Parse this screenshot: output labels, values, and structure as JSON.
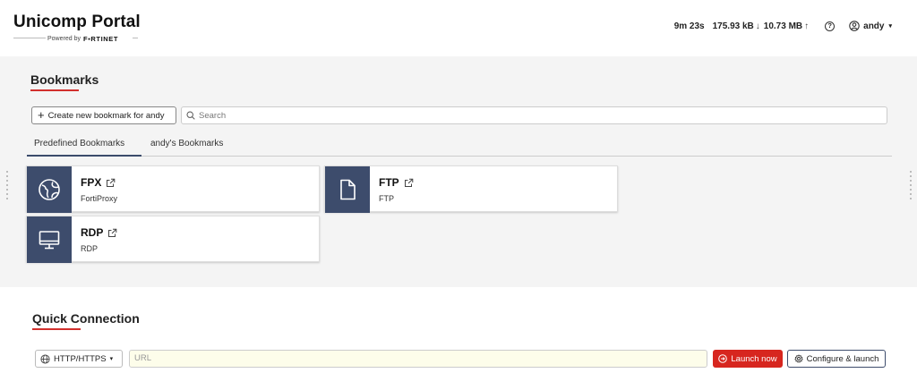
{
  "header": {
    "title": "Unicomp Portal",
    "powered_by": "Powered by",
    "fortinet": "F▪RTINET",
    "session_time": "9m 23s",
    "received": "175.93 kB",
    "received_arrow": "↓",
    "sent": "10.73 MB",
    "sent_arrow": "↑",
    "help_glyph": "?",
    "user": "andy",
    "user_caret": "▾"
  },
  "bookmarks": {
    "title": "Bookmarks",
    "create_button": "Create new bookmark for andy",
    "create_plus": "+",
    "search_placeholder": "Search",
    "tabs": [
      "Predefined Bookmarks",
      "andy's Bookmarks"
    ],
    "active_tab": 0,
    "items": [
      {
        "name": "FPX",
        "sub": "FortiProxy",
        "icon": "globe-icon"
      },
      {
        "name": "FTP",
        "sub": "FTP",
        "icon": "file-icon"
      },
      {
        "name": "RDP",
        "sub": "RDP",
        "icon": "monitor-icon"
      }
    ]
  },
  "quick_connection": {
    "title": "Quick Connection",
    "protocol": "HTTP/HTTPS",
    "protocol_caret": "▾",
    "url_placeholder": "URL",
    "launch_label": "Launch now",
    "configure_label": "Configure & launch"
  },
  "colors": {
    "accent_red": "#d7261f",
    "icon_bg": "#3d4c6c"
  }
}
